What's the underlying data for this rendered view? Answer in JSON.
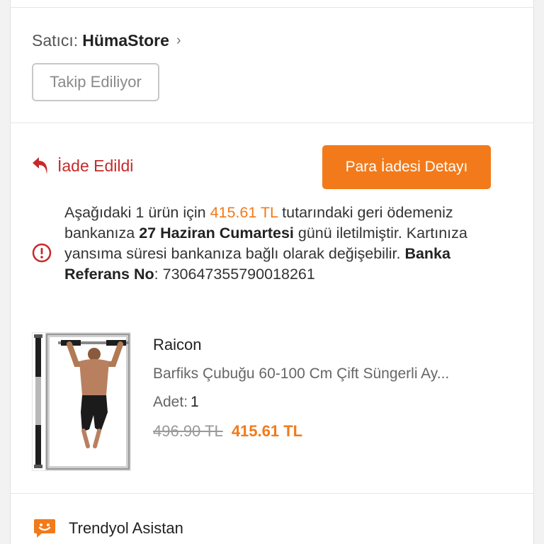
{
  "seller": {
    "label": "Satıcı:",
    "name": "HümaStore",
    "chevron": "›",
    "follow_button": "Takip Ediliyor"
  },
  "order": {
    "status_icon": "return-arrow-icon",
    "status_label": "İade Edildi",
    "refund_button": "Para İadesi Detayı",
    "info": {
      "t1": "Aşağıdaki 1 ürün için ",
      "amount": "415.61 TL",
      "t2": " tutarındaki geri ödemeniz bankanıza ",
      "date": "27 Haziran Cumartesi",
      "t3": " günü iletilmiştir. Kartınıza yansıma süresi bankanıza bağlı olarak değişebilir. ",
      "ref_label": "Banka Referans No",
      "t4": ": ",
      "ref_no": "730647355790018261"
    }
  },
  "product": {
    "brand": "Raicon",
    "title": "Barfiks Çubuğu 60-100 Cm Çift Süngerli Ay...",
    "qty_label": "Adet:",
    "qty": "1",
    "old_price": "496.90 TL",
    "new_price": "415.61 TL"
  },
  "assistant": {
    "icon": "chat-smile-icon",
    "label": "Trendyol Asistan"
  },
  "colors": {
    "accent": "#f27a1a",
    "status_red": "#c62a2a"
  }
}
